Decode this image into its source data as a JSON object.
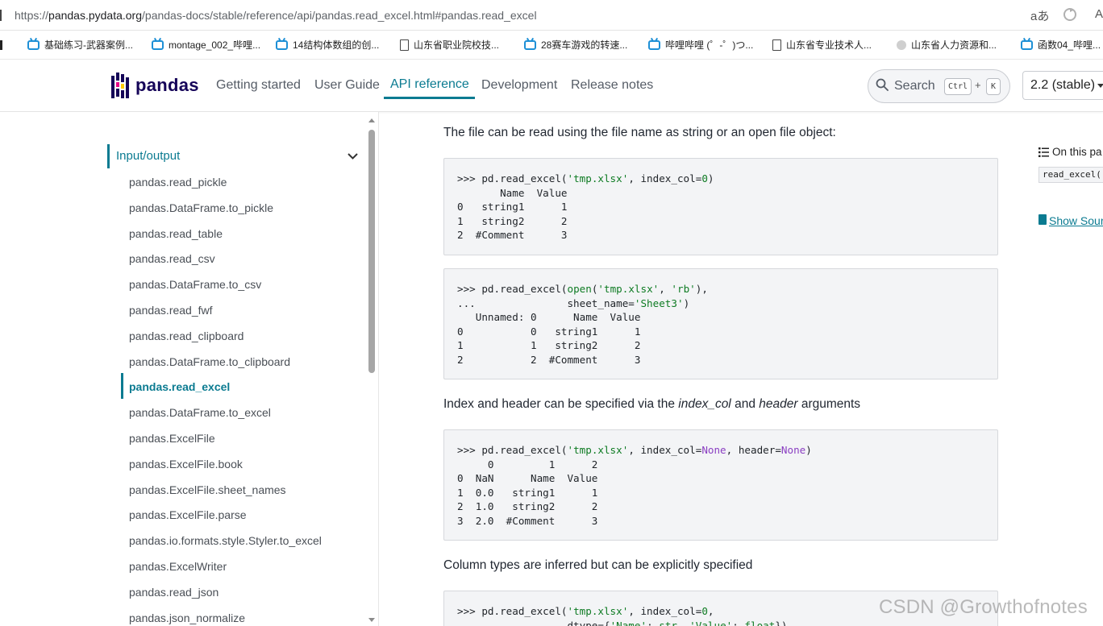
{
  "browser": {
    "url_prefix": "https://",
    "url_host": "pandas.pydata.org",
    "url_path": "/pandas-docs/stable/reference/api/pandas.read_excel.html#pandas.read_excel",
    "read_aloud_icon": "aあ",
    "bookmarks": [
      {
        "icon": "bilibili",
        "label": "基础练习-武器案例..."
      },
      {
        "icon": "bilibili",
        "label": "montage_002_哔哩..."
      },
      {
        "icon": "bilibili",
        "label": "14结构体数组的创..."
      },
      {
        "icon": "doc",
        "label": "山东省职业院校技..."
      },
      {
        "icon": "bilibili",
        "label": "28赛车游戏的转速..."
      },
      {
        "icon": "bilibili",
        "label": "哔哩哔哩 (゜-゜)つ..."
      },
      {
        "icon": "doc",
        "label": "山东省专业技术人..."
      },
      {
        "icon": "globe",
        "label": "山东省人力资源和..."
      },
      {
        "icon": "bilibili",
        "label": "函数04_哔哩..."
      }
    ]
  },
  "navbar": {
    "logo_text": "pandas",
    "links": [
      "Getting started",
      "User Guide",
      "API reference",
      "Development",
      "Release notes"
    ],
    "active_link": "API reference",
    "search": {
      "label": "Search",
      "kbd_ctrl": "Ctrl",
      "kbd_plus": "+",
      "kbd_k": "K"
    },
    "version": "2.2 (stable)"
  },
  "sidebar": {
    "section": "Input/output",
    "items": [
      "pandas.read_pickle",
      "pandas.DataFrame.to_pickle",
      "pandas.read_table",
      "pandas.read_csv",
      "pandas.DataFrame.to_csv",
      "pandas.read_fwf",
      "pandas.read_clipboard",
      "pandas.DataFrame.to_clipboard",
      "pandas.read_excel",
      "pandas.DataFrame.to_excel",
      "pandas.ExcelFile",
      "pandas.ExcelFile.book",
      "pandas.ExcelFile.sheet_names",
      "pandas.ExcelFile.parse",
      "pandas.io.formats.style.Styler.to_excel",
      "pandas.ExcelWriter",
      "pandas.read_json",
      "pandas.json_normalize"
    ],
    "active_item": "pandas.read_excel"
  },
  "content": {
    "para1": "The file can be read using the file name as string or an open file object:",
    "code1": [
      ">>> pd.read_excel('tmp.xlsx', index_col=0)",
      "       Name  Value",
      "0   string1      1",
      "1   string2      2",
      "2  #Comment      3"
    ],
    "code2": [
      ">>> pd.read_excel(open('tmp.xlsx', 'rb'),",
      "...               sheet_name='Sheet3')",
      "   Unnamed: 0      Name  Value",
      "0           0   string1      1",
      "1           1   string2      2",
      "2           2  #Comment      3"
    ],
    "para2_a": "Index and header can be specified via the ",
    "para2_em1": "index_col",
    "para2_b": " and ",
    "para2_em2": "header",
    "para2_c": " arguments",
    "code3": [
      ">>> pd.read_excel('tmp.xlsx', index_col=None, header=None)",
      "     0         1      2",
      "0  NaN      Name  Value",
      "1  0.0   string1      1",
      "2  1.0   string2      2",
      "3  2.0  #Comment      3"
    ],
    "para3": "Column types are inferred but can be explicitly specified",
    "code4": [
      ">>> pd.read_excel('tmp.xlsx', index_col=0,",
      "...               dtype={'Name': str, 'Value': float})"
    ]
  },
  "toc": {
    "title": "On this pa",
    "code": "read_excel(",
    "show_source": "Show Sour"
  },
  "watermark": "CSDN @Growthofnotes",
  "colors": {
    "accent": "#0b7b91",
    "brand": "#150458",
    "code_bg": "#f3f4f6",
    "string": "#0e7b23",
    "keyword_none": "#8a3ec2"
  }
}
